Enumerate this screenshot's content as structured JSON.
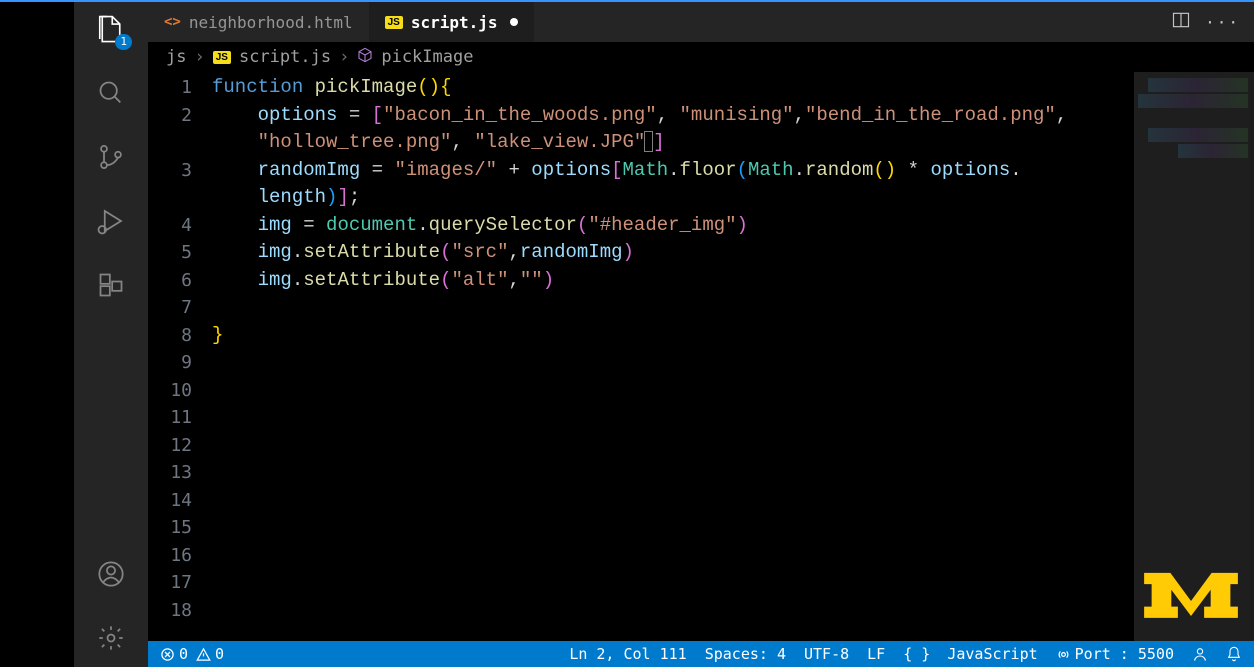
{
  "activity": {
    "badge": "1"
  },
  "tabs": {
    "inactive": {
      "icon": "<>",
      "label": "neighborhood.html"
    },
    "active": {
      "icon": "JS",
      "label": "script.js"
    }
  },
  "breadcrumbs": {
    "folder": "js",
    "file": "script.js",
    "symbol": "pickImage"
  },
  "gutter_lines": [
    "1",
    "2",
    "",
    "3",
    "",
    "4",
    "5",
    "6",
    "7",
    "8",
    "9",
    "10",
    "11",
    "12",
    "13",
    "14",
    "15",
    "16",
    "17",
    "18"
  ],
  "code": {
    "l1": {
      "kw": "function",
      "fn": "pickImage",
      "rest": "(){"
    },
    "l2a": {
      "id": "options",
      "arr": "[",
      "o": "[",
      "s1": "\"bacon_in_the_woods.png\"",
      "c": ", ",
      "s2": "\"munising\"",
      "c2": ",",
      "s3": "\"bend_in_the_road.png\"",
      "c3": ","
    },
    "l2b": {
      "s4": "\"hollow_tree.png\"",
      "c": ", ",
      "s5": "\"lake_view.JPG\"",
      "close": "]"
    },
    "l3a": {
      "id": "randomImg",
      "eq": " = ",
      "s": "\"images/\"",
      "plus": " + ",
      "id2": "options",
      "ob": "[",
      "obj": "Math",
      "dot": ".",
      "fn": "floor",
      "op": "(",
      "obj2": "Math",
      "dot2": ".",
      "fn2": "random",
      "op2": "()",
      "mul": " * ",
      "id3": "options",
      "dot3": "."
    },
    "l3b": {
      "id": "length",
      "cp": ")",
      "cb": "]",
      "sc": ";"
    },
    "l4": {
      "id": "img",
      "eq": " = ",
      "obj": "document",
      "dot": ".",
      "fn": "querySelector",
      "op": "(",
      "s": "\"#header_img\"",
      "cp": ")"
    },
    "l5": {
      "id": "img",
      "dot": ".",
      "fn": "setAttribute",
      "op": "(",
      "s1": "\"src\"",
      "c": ",",
      "id2": "randomImg",
      "cp": ")"
    },
    "l6": {
      "id": "img",
      "dot": ".",
      "fn": "setAttribute",
      "op": "(",
      "s1": "\"alt\"",
      "c": ",",
      "s2": "\"\"",
      "cp": ")"
    },
    "l8": {
      "cb": "}"
    }
  },
  "status": {
    "errors": "0",
    "warnings": "0",
    "pos": "Ln 2, Col 111",
    "spaces": "Spaces: 4",
    "enc": "UTF-8",
    "eol": "LF",
    "lang": "JavaScript",
    "port": "Port : 5500"
  }
}
